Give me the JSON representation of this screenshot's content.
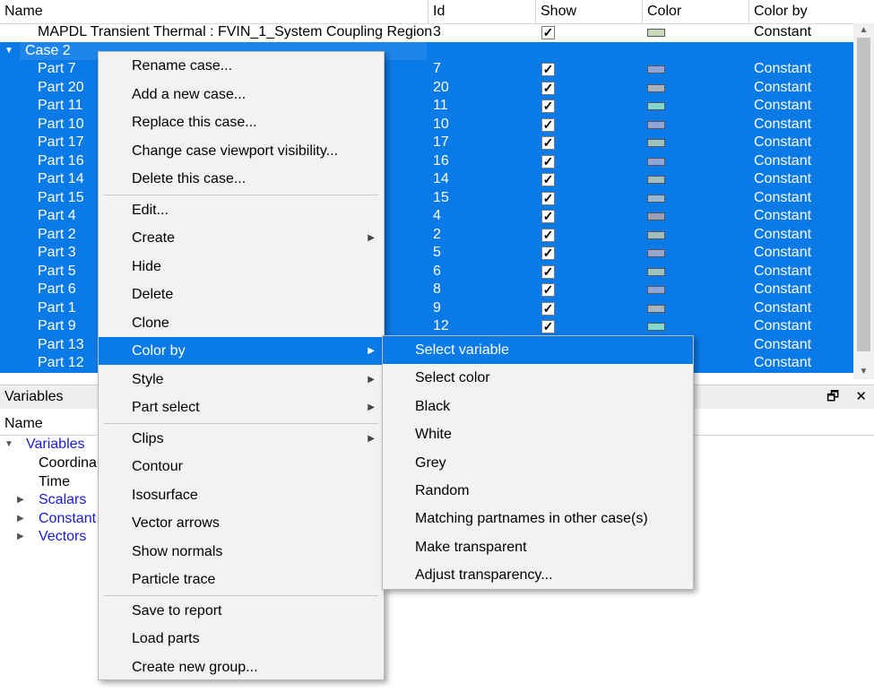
{
  "table": {
    "headers": {
      "name": "Name",
      "id": "Id",
      "show": "Show",
      "color": "Color",
      "color_by": "Color by"
    },
    "top_row": {
      "name": "MAPDL Transient Thermal : FVIN_1_System Coupling Region",
      "id": "3",
      "show": "✓",
      "color": "#c8d8b8",
      "color_by": "Constant"
    },
    "case": {
      "name": "Case 2"
    },
    "parts": [
      {
        "name": "Part 7",
        "id": "7",
        "show": "✓",
        "color": "#8fa5d8",
        "color_by": "Constant"
      },
      {
        "name": "Part 20",
        "id": "20",
        "show": "✓",
        "color": "#a7b3bf",
        "color_by": "Constant"
      },
      {
        "name": "Part 11",
        "id": "11",
        "show": "✓",
        "color": "#84d7cf",
        "color_by": "Constant"
      },
      {
        "name": "Part 10",
        "id": "10",
        "show": "✓",
        "color": "#8fa5d8",
        "color_by": "Constant"
      },
      {
        "name": "Part 17",
        "id": "17",
        "show": "✓",
        "color": "#9cc3c0",
        "color_by": "Constant"
      },
      {
        "name": "Part 16",
        "id": "16",
        "show": "✓",
        "color": "#8fa5d8",
        "color_by": "Constant"
      },
      {
        "name": "Part 14",
        "id": "14",
        "show": "✓",
        "color": "#a3bcc0",
        "color_by": "Constant"
      },
      {
        "name": "Part 15",
        "id": "15",
        "show": "✓",
        "color": "#98b6d8",
        "color_by": "Constant"
      },
      {
        "name": "Part 4",
        "id": "4",
        "show": "✓",
        "color": "#9aa0b5",
        "color_by": "Constant"
      },
      {
        "name": "Part 2",
        "id": "2",
        "show": "✓",
        "color": "#a3bcc0",
        "color_by": "Constant"
      },
      {
        "name": "Part 3",
        "id": "5",
        "show": "✓",
        "color": "#9aa5d0",
        "color_by": "Constant"
      },
      {
        "name": "Part 5",
        "id": "6",
        "show": "✓",
        "color": "#9cc3c0",
        "color_by": "Constant"
      },
      {
        "name": "Part 6",
        "id": "8",
        "show": "✓",
        "color": "#8fa5d8",
        "color_by": "Constant"
      },
      {
        "name": "Part 1",
        "id": "9",
        "show": "✓",
        "color": "#a7b3bf",
        "color_by": "Constant"
      },
      {
        "name": "Part 9",
        "id": "12",
        "show": "✓",
        "color": "#84d7cf",
        "color_by": "Constant"
      },
      {
        "name": "Part 13",
        "id": "",
        "show": "",
        "color": "",
        "color_by": "Constant"
      },
      {
        "name": "Part 12",
        "id": "",
        "show": "",
        "color": "",
        "color_by": "Constant"
      }
    ]
  },
  "variables_panel": {
    "title": "Variables",
    "restore_glyph": "🗗",
    "close_glyph": "✕",
    "column_header": "Name",
    "root": "Variables",
    "items": [
      {
        "label": "Coordina",
        "link": false,
        "expandable": false
      },
      {
        "label": "Time",
        "link": false,
        "expandable": false
      },
      {
        "label": "Scalars",
        "link": true,
        "expandable": true
      },
      {
        "label": "Constant",
        "link": true,
        "expandable": true
      },
      {
        "label": "Vectors",
        "link": true,
        "expandable": true
      }
    ]
  },
  "context_menu": {
    "groups": [
      [
        "Rename case...",
        "Add a new case...",
        "Replace this case...",
        "Change case viewport visibility...",
        "Delete this case..."
      ],
      [
        "Edit...",
        "Create",
        "Hide",
        "Delete",
        "Clone",
        "Color by",
        "Style",
        "Part select"
      ],
      [
        "Clips",
        "Contour",
        "Isosurface",
        "Vector arrows",
        "Show normals",
        "Particle trace"
      ],
      [
        "Save to report",
        "Load parts",
        "Create new group..."
      ]
    ],
    "submenu_items": [
      "Create",
      "Color by",
      "Style",
      "Part select",
      "Clips"
    ],
    "highlighted": "Color by"
  },
  "color_by_submenu": {
    "items": [
      "Select variable",
      "Select color",
      "Black",
      "White",
      "Grey",
      "Random",
      "Matching partnames in other case(s)",
      "Make transparent",
      "Adjust transparency..."
    ],
    "highlighted": "Select variable"
  }
}
